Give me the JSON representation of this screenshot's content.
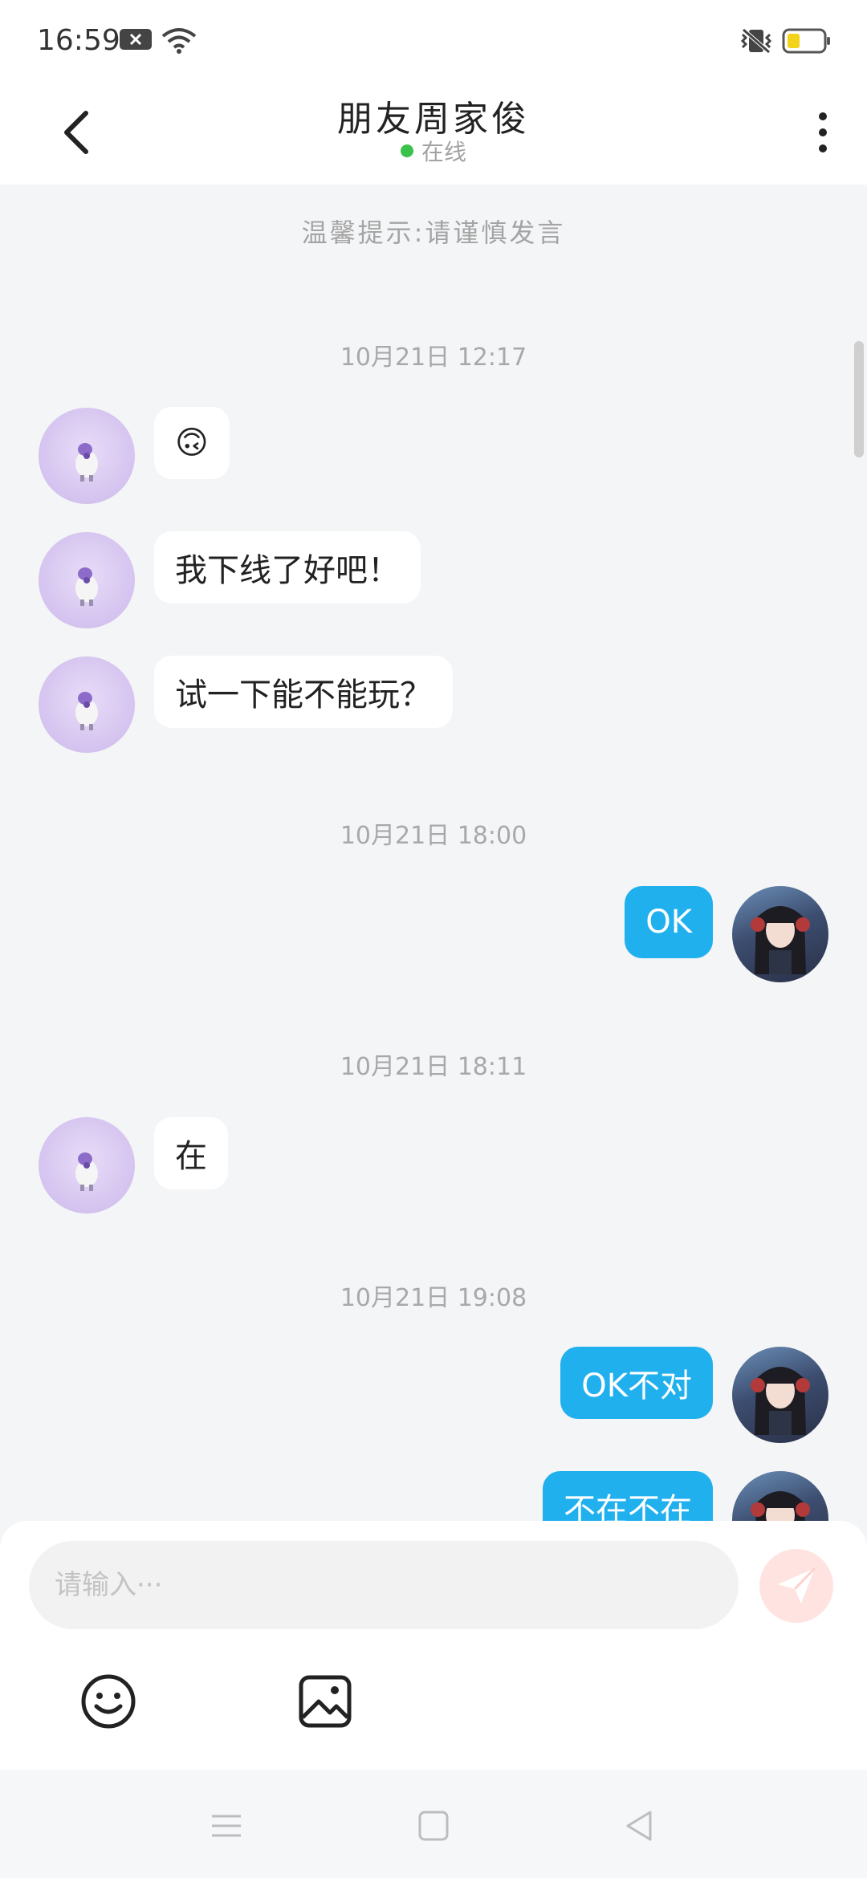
{
  "status_bar": {
    "time": "16:59",
    "icons": [
      "notification-badge-icon",
      "wifi-icon",
      "vibrate-icon",
      "battery-icon"
    ],
    "battery_color": "#f3d21a"
  },
  "header": {
    "title": "朋友周家俊",
    "presence": "在线",
    "presence_color": "#3ac24b",
    "icons": [
      "back-arrow-icon",
      "more-vertical-icon"
    ]
  },
  "chat": {
    "tip": "温馨提示:请谨慎发言",
    "outgoing_bubble_color": "#21b0ee",
    "messages": [
      {
        "timestamp": "10月21日 12:17"
      },
      {
        "sender": "friend",
        "text": "🙃"
      },
      {
        "sender": "friend",
        "text": "我下线了好吧！"
      },
      {
        "sender": "friend",
        "text": "试一下能不能玩？"
      },
      {
        "timestamp": "10月21日 18:00"
      },
      {
        "sender": "me",
        "text": "OK"
      },
      {
        "timestamp": "10月21日 18:11"
      },
      {
        "sender": "friend",
        "text": "在"
      },
      {
        "timestamp": "10月21日 19:08"
      },
      {
        "sender": "me",
        "text": "OK不对"
      },
      {
        "sender": "me",
        "text": "不在不在"
      }
    ]
  },
  "composer": {
    "placeholder": "请输入···",
    "icons": [
      "send-icon",
      "emoji-icon",
      "image-icon"
    ],
    "send_button_color": "#ffe3e0"
  },
  "nav_bar": {
    "icons": [
      "menu-lines-icon",
      "home-square-icon",
      "back-triangle-icon"
    ]
  }
}
